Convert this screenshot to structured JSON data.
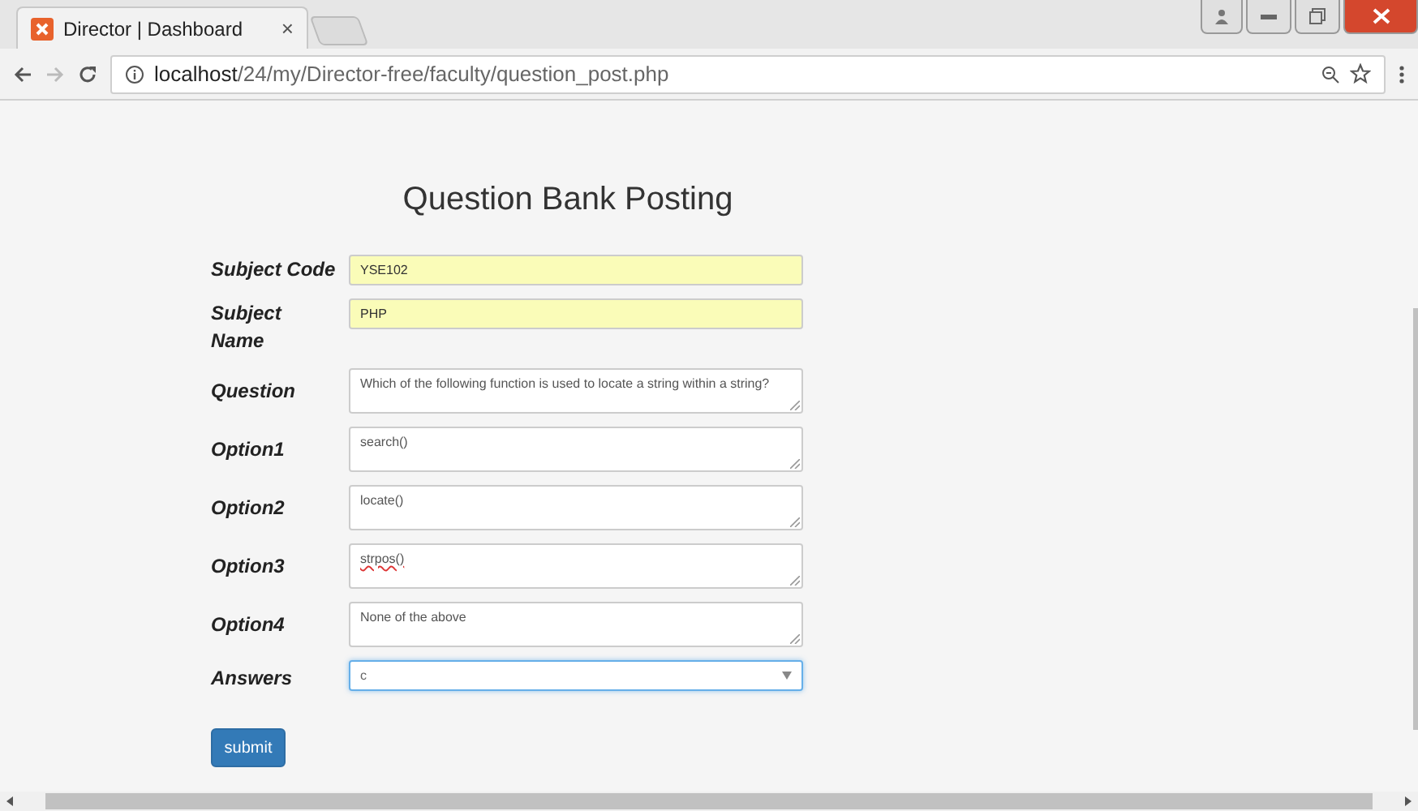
{
  "browser": {
    "tab": {
      "title": "Director | Dashboard",
      "close": "×"
    },
    "url": {
      "host": "localhost",
      "path": "/24/my/Director-free/faculty/question_post.php"
    }
  },
  "page": {
    "title": "Question Bank Posting",
    "fields": [
      {
        "label": "Subject Code",
        "kind": "input",
        "value": "YSE102",
        "autofilled": true,
        "focused": false,
        "misspelled": false
      },
      {
        "label": "Subject Name",
        "kind": "input",
        "value": "PHP",
        "autofilled": true,
        "focused": false,
        "misspelled": false
      },
      {
        "label": "Question",
        "kind": "textarea",
        "value": "Which of the following function is used to locate a string within a string?",
        "autofilled": false,
        "focused": false,
        "misspelled": false
      },
      {
        "label": "Option1",
        "kind": "textarea",
        "value": "search()",
        "autofilled": false,
        "focused": false,
        "misspelled": false
      },
      {
        "label": "Option2",
        "kind": "textarea",
        "value": "locate()",
        "autofilled": false,
        "focused": false,
        "misspelled": false
      },
      {
        "label": "Option3",
        "kind": "textarea",
        "value": "strpos()",
        "autofilled": false,
        "focused": false,
        "misspelled": true
      },
      {
        "label": "Option4",
        "kind": "textarea",
        "value": "None of the above",
        "autofilled": false,
        "focused": false,
        "misspelled": false
      },
      {
        "label": "Answers",
        "kind": "select",
        "value": "c",
        "autofilled": false,
        "focused": true,
        "misspelled": false
      }
    ],
    "submit": "submit"
  }
}
